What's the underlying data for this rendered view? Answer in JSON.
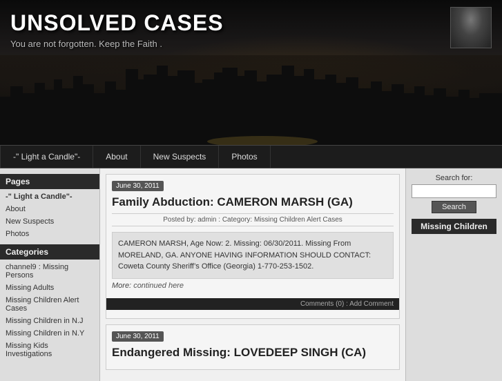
{
  "header": {
    "title": "UNSOLVED CASES",
    "subtitle": "You are not forgotten. Keep the Faith ."
  },
  "navbar": {
    "items": [
      {
        "id": "nav-light-candle",
        "label": "-\" Light a Candle\"-"
      },
      {
        "id": "nav-about",
        "label": "About"
      },
      {
        "id": "nav-new-suspects",
        "label": "New Suspects"
      },
      {
        "id": "nav-photos",
        "label": "Photos"
      }
    ]
  },
  "sidebar": {
    "pages_title": "Pages",
    "pages_links": [
      {
        "label": "-\" Light a Candle\"-",
        "bold": true
      },
      {
        "label": "About",
        "bold": false
      },
      {
        "label": "New Suspects",
        "bold": false
      },
      {
        "label": "Photos",
        "bold": false
      }
    ],
    "categories_title": "Categories",
    "categories_links": [
      {
        "label": "channel9 : Missing Persons"
      },
      {
        "label": "Missing Adults"
      },
      {
        "label": "Missing Children Alert Cases"
      },
      {
        "label": "Missing Children in N.J"
      },
      {
        "label": "Missing Children in N.Y"
      },
      {
        "label": "Missing Kids Investigations"
      }
    ]
  },
  "posts": [
    {
      "date": "June 30, 2011",
      "title": "Family Abduction: CAMERON MARSH (GA)",
      "meta": "Posted by: admin  :  Category: Missing Children Alert Cases",
      "body": "CAMERON MARSH, Age Now: 2. Missing: 06/30/2011. Missing From MORELAND, GA. ANYONE HAVING INFORMATION SHOULD CONTACT: Coweta County Sheriff’s Office (Georgia) 1-770-253-1502.",
      "more_label": "More:",
      "more_link": "continued here",
      "footer": "Comments (0)  :  Add Comment"
    },
    {
      "date": "June 30, 2011",
      "title": "Endangered Missing: LOVEDEEP SINGH (CA)",
      "meta": "",
      "body": "",
      "more_label": "",
      "more_link": "",
      "footer": ""
    }
  ],
  "right_sidebar": {
    "search_label": "Search for:",
    "search_placeholder": "",
    "search_button": "Search",
    "missing_children_title": "Missing Children"
  }
}
